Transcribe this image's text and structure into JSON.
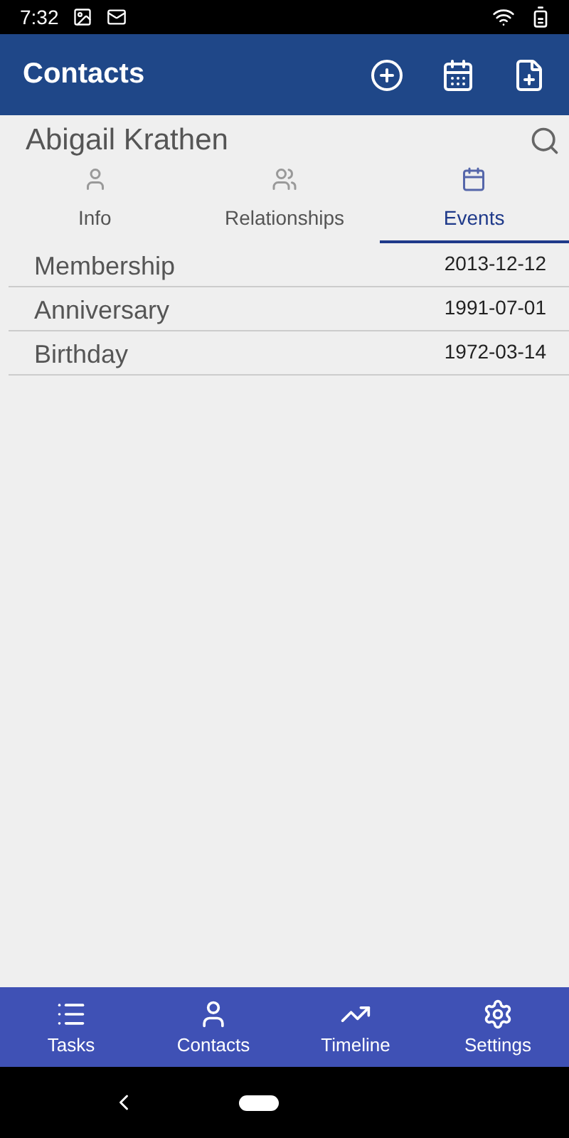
{
  "status_bar": {
    "time": "7:32"
  },
  "app_bar": {
    "title": "Contacts"
  },
  "contact": {
    "name": "Abigail Krathen"
  },
  "tabs": [
    {
      "label": "Info",
      "kind": "person",
      "selected": false
    },
    {
      "label": "Relationships",
      "kind": "group",
      "selected": false
    },
    {
      "label": "Events",
      "kind": "calendar",
      "selected": true
    }
  ],
  "events": [
    {
      "name": "Membership",
      "date": "2013-12-12"
    },
    {
      "name": "Anniversary",
      "date": "1991-07-01"
    },
    {
      "name": "Birthday",
      "date": "1972-03-14"
    }
  ],
  "bottom_nav": [
    {
      "label": "Tasks",
      "kind": "list"
    },
    {
      "label": "Contacts",
      "kind": "person"
    },
    {
      "label": "Timeline",
      "kind": "chart"
    },
    {
      "label": "Settings",
      "kind": "gear"
    }
  ]
}
